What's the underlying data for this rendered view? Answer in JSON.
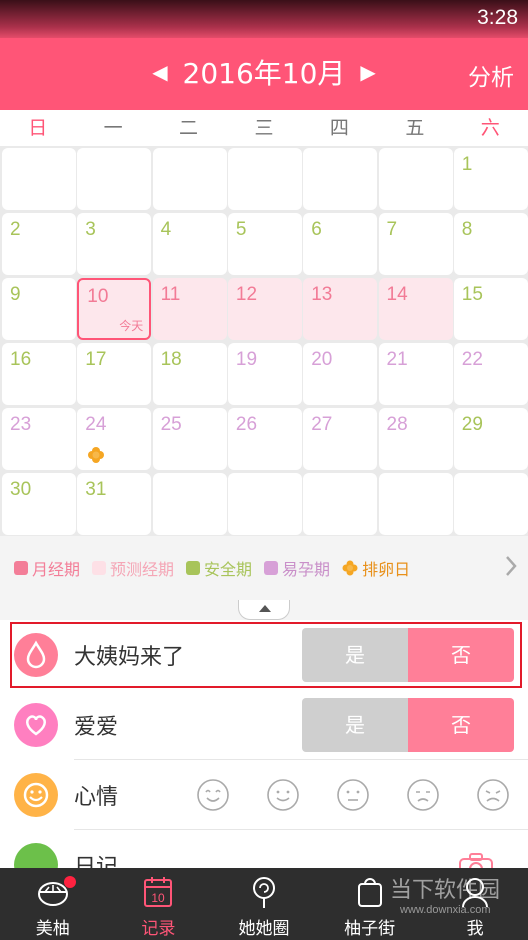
{
  "status_bar": {
    "time": "3:28"
  },
  "header": {
    "title": "2016年10月",
    "prev_arrow": "◀",
    "next_arrow": "▶",
    "analysis_label": "分析"
  },
  "weekdays": [
    "日",
    "一",
    "二",
    "三",
    "四",
    "五",
    "六"
  ],
  "calendar": {
    "today_label": "今天",
    "days": [
      {
        "n": "1",
        "type": "safe"
      },
      {
        "n": "2",
        "type": "safe"
      },
      {
        "n": "3",
        "type": "safe"
      },
      {
        "n": "4",
        "type": "safe"
      },
      {
        "n": "5",
        "type": "safe"
      },
      {
        "n": "6",
        "type": "safe"
      },
      {
        "n": "7",
        "type": "safe"
      },
      {
        "n": "8",
        "type": "safe"
      },
      {
        "n": "9",
        "type": "safe"
      },
      {
        "n": "10",
        "type": "pred"
      },
      {
        "n": "11",
        "type": "pred"
      },
      {
        "n": "12",
        "type": "pred"
      },
      {
        "n": "13",
        "type": "pred"
      },
      {
        "n": "14",
        "type": "pred"
      },
      {
        "n": "15",
        "type": "safe"
      },
      {
        "n": "16",
        "type": "safe"
      },
      {
        "n": "17",
        "type": "safe"
      },
      {
        "n": "18",
        "type": "safe"
      },
      {
        "n": "19",
        "type": "fert"
      },
      {
        "n": "20",
        "type": "fert"
      },
      {
        "n": "21",
        "type": "fert"
      },
      {
        "n": "22",
        "type": "fert"
      },
      {
        "n": "23",
        "type": "fert"
      },
      {
        "n": "24",
        "type": "fert"
      },
      {
        "n": "25",
        "type": "fert"
      },
      {
        "n": "26",
        "type": "fert"
      },
      {
        "n": "27",
        "type": "fert"
      },
      {
        "n": "28",
        "type": "fert"
      },
      {
        "n": "29",
        "type": "safe"
      },
      {
        "n": "30",
        "type": "safe"
      },
      {
        "n": "31",
        "type": "safe"
      }
    ]
  },
  "legend": {
    "items": [
      {
        "label": "月经期",
        "color": "#f37e98"
      },
      {
        "label": "预测经期",
        "color": "#fde0e6"
      },
      {
        "label": "安全期",
        "color": "#a8c45a"
      },
      {
        "label": "易孕期",
        "color": "#d7a0d7"
      },
      {
        "label": "排卵日",
        "color": "#f5a623"
      }
    ]
  },
  "records": {
    "period": {
      "label": "大姨妈来了",
      "yes": "是",
      "no": "否"
    },
    "love": {
      "label": "爱爱",
      "yes": "是",
      "no": "否"
    },
    "mood": {
      "label": "心情"
    },
    "diary": {
      "label": "日记"
    }
  },
  "nav": {
    "items": [
      {
        "label": "美柚"
      },
      {
        "label": "记录"
      },
      {
        "label": "她她圈"
      },
      {
        "label": "柚子街"
      },
      {
        "label": "我"
      }
    ]
  },
  "watermark": {
    "text": "当下软件园",
    "url": "www.downxia.com"
  },
  "colors": {
    "brand": "#ff5577",
    "safe": "#a8c45a",
    "fertile": "#d7a0d7",
    "predicted": "#fde7ec"
  }
}
